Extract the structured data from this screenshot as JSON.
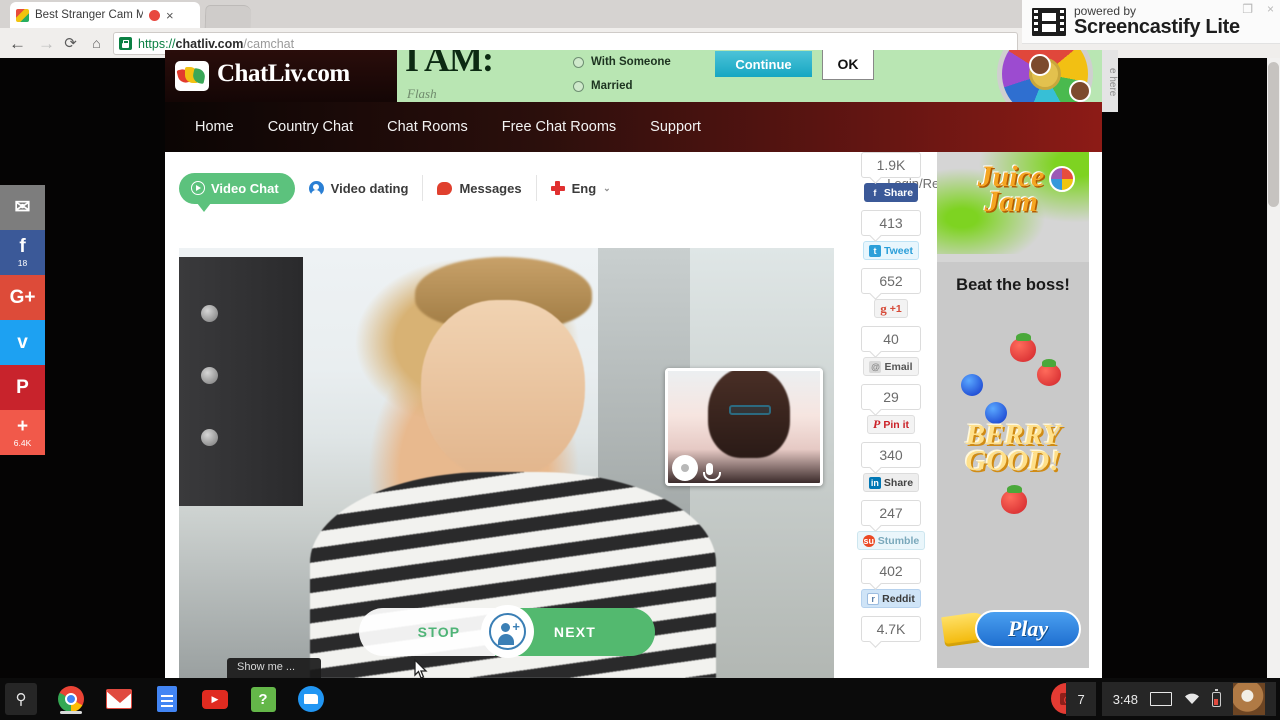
{
  "browser": {
    "tab_title": "Best Stranger Cam M",
    "tab_close": "×",
    "url_scheme": "https://",
    "url_domain": "chatliv.com",
    "url_path": "/camchat",
    "back_icon": "←",
    "forward_icon": "→",
    "reload_icon": "⟳",
    "home_icon": "⌂"
  },
  "screencastify": {
    "powered_by": "powered by",
    "name": "Screencastify Lite",
    "restore": "❐",
    "close": "×"
  },
  "social_sidebar": [
    {
      "name": "email",
      "glyph": "✉",
      "count": "",
      "color": "#7d7d7d"
    },
    {
      "name": "facebook",
      "glyph": "f",
      "count": "18",
      "color": "#3b5998"
    },
    {
      "name": "google-plus",
      "glyph": "G+",
      "count": "",
      "color": "#dd4b39"
    },
    {
      "name": "twitter",
      "glyph": "ᴠ",
      "count": "",
      "color": "#1da1f2"
    },
    {
      "name": "pinterest",
      "glyph": "P",
      "count": "",
      "color": "#c8232c"
    },
    {
      "name": "share-more",
      "glyph": "+",
      "count": "6.4K",
      "color": "#f1594a"
    }
  ],
  "site": {
    "logo_text": "ChatLiv.com",
    "nav": [
      "Home",
      "Country Chat",
      "Chat Rooms",
      "Free Chat Rooms",
      "Support"
    ]
  },
  "ad_top": {
    "headline": "I AM:",
    "flash_label": "Flash",
    "option_1": "With Someone",
    "option_2": "Married",
    "continue_label": "Continue",
    "ok_label": "OK"
  },
  "tabs": {
    "video_chat": "Video Chat",
    "video_dating": "Video dating",
    "messages": "Messages",
    "language": "Eng",
    "language_caret": "⌄",
    "login": "Login/Registration",
    "avatar_caret": "⌄"
  },
  "video": {
    "ribbon_text": "Show me ...",
    "stop_label": "STOP",
    "next_label": "NEXT",
    "add_plus": "+"
  },
  "share_rail": [
    {
      "count": "1.9K",
      "button": "Share",
      "network": "facebook"
    },
    {
      "count": "413",
      "button": "Tweet",
      "network": "twitter"
    },
    {
      "count": "652",
      "button": "+1",
      "network": "googleplus"
    },
    {
      "count": "40",
      "button": "Email",
      "network": "email"
    },
    {
      "count": "29",
      "button": "Pin it",
      "network": "pinterest"
    },
    {
      "count": "340",
      "button": "Share",
      "network": "linkedin"
    },
    {
      "count": "247",
      "button": "Stumble",
      "network": "stumbleupon"
    },
    {
      "count": "402",
      "button": "Reddit",
      "network": "reddit"
    },
    {
      "count": "4.7K",
      "button": "",
      "network": "more"
    }
  ],
  "right_ad": {
    "logo_line1": "Juice",
    "logo_line2": "Jam",
    "tagline": "Beat the boss!",
    "berry_line1": "BERRY",
    "berry_line2": "GOOD!",
    "play_label": "Play"
  },
  "side_tab_label": "e here",
  "taskbar": {
    "search_icon": "⚲",
    "apps": [
      "chrome",
      "gmail",
      "docs",
      "youtube",
      "help",
      "files"
    ],
    "notification_count": "7",
    "clock": "3:48"
  }
}
